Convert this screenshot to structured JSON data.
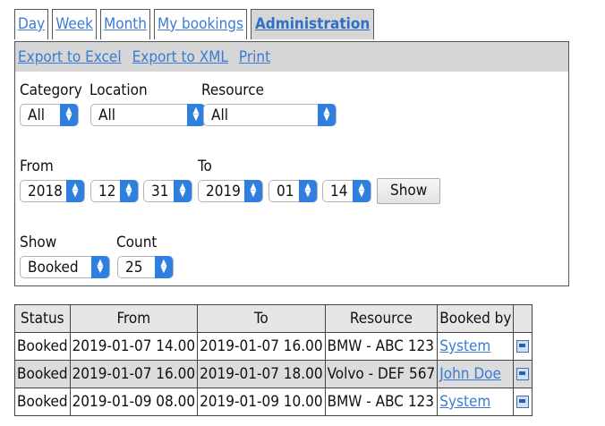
{
  "tabs": [
    {
      "label": "Day",
      "active": false
    },
    {
      "label": "Week",
      "active": false
    },
    {
      "label": "Month",
      "active": false
    },
    {
      "label": "My bookings",
      "active": false
    },
    {
      "label": "Administration",
      "active": true
    }
  ],
  "toolbar": {
    "export_excel": "Export to Excel",
    "export_xml": "Export to XML",
    "print": "Print"
  },
  "filters": {
    "category_label": "Category",
    "category_value": "All",
    "location_label": "Location",
    "location_value": "All",
    "resource_label": "Resource",
    "resource_value": "All",
    "from_label": "From",
    "from_year": "2018",
    "from_month": "12",
    "from_day": "31",
    "to_label": "To",
    "to_year": "2019",
    "to_month": "01",
    "to_day": "14",
    "show_button": "Show",
    "show_label": "Show",
    "show_value": "Booked",
    "count_label": "Count",
    "count_value": "25"
  },
  "table": {
    "headers": [
      "Status",
      "From",
      "To",
      "Resource",
      "Booked by",
      ""
    ],
    "rows": [
      {
        "status": "Booked",
        "from": "2019-01-07 14.00",
        "to": "2019-01-07 16.00",
        "resource": "BMW - ABC 123",
        "booked_by": "System"
      },
      {
        "status": "Booked",
        "from": "2019-01-07 16.00",
        "to": "2019-01-07 18.00",
        "resource": "Volvo - DEF 567",
        "booked_by": "John Doe"
      },
      {
        "status": "Booked",
        "from": "2019-01-09 08.00",
        "to": "2019-01-09 10.00",
        "resource": "BMW - ABC 123",
        "booked_by": "System"
      }
    ]
  },
  "icons": {
    "row_detail": "details-icon",
    "select_chevron": "chevron-updown-icon"
  }
}
